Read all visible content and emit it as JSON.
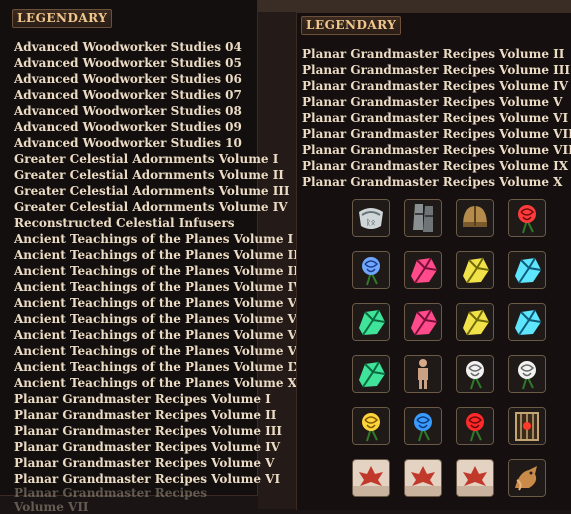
{
  "left_panel": {
    "header": "LEGENDARY",
    "items": [
      "Advanced Woodworker Studies 04",
      "Advanced Woodworker Studies 05",
      "Advanced Woodworker Studies 06",
      "Advanced Woodworker Studies 07",
      "Advanced Woodworker Studies 08",
      "Advanced Woodworker Studies 09",
      "Advanced Woodworker Studies 10",
      "Greater Celestial Adornments Volume I",
      "Greater Celestial Adornments Volume II",
      "Greater Celestial Adornments Volume III",
      "Greater Celestial Adornments Volume IV",
      "Reconstructed Celestial Infusers",
      "Ancient Teachings of the Planes Volume I",
      "Ancient Teachings of the Planes Volume II",
      "Ancient Teachings of the Planes Volume III",
      "Ancient Teachings of the Planes Volume IV",
      "Ancient Teachings of the Planes Volume V",
      "Ancient Teachings of the Planes Volume VI",
      "Ancient Teachings of the Planes Volume VII",
      "Ancient Teachings of the Planes Volume VIII",
      "Ancient Teachings of the Planes Volume IX",
      "Ancient Teachings of the Planes Volume X",
      "Planar Grandmaster Recipes Volume I",
      "Planar Grandmaster Recipes Volume II",
      "Planar Grandmaster Recipes Volume III",
      "Planar Grandmaster Recipes Volume IV",
      "Planar Grandmaster Recipes Volume V",
      "Planar Grandmaster Recipes Volume VI"
    ],
    "cutoff_text": "Planar Grandmaster Recipes Volume VII"
  },
  "right_panel": {
    "header": "LEGENDARY",
    "items": [
      "Planar Grandmaster Recipes Volume II",
      "Planar Grandmaster Recipes Volume III",
      "Planar Grandmaster Recipes Volume IV",
      "Planar Grandmaster Recipes Volume V",
      "Planar Grandmaster Recipes Volume VI",
      "Planar Grandmaster Recipes Volume VII",
      "Planar Grandmaster Recipes Volume VIII",
      "Planar Grandmaster Recipes Volume IX",
      "Planar Grandmaster Recipes Volume X"
    ],
    "icons": [
      [
        "bracer-icon",
        "greaves-icon",
        "helmet-icon",
        "red-lily-icon"
      ],
      [
        "blue-flower-icon",
        "pink-crystal-icon",
        "yellow-crystal-icon",
        "cyan-crystal-icon"
      ],
      [
        "green-crystal-icon",
        "pink-crystal-icon",
        "yellow-crystal-icon",
        "cyan-crystal-icon"
      ],
      [
        "green-crystal-icon",
        "mannequin-icon",
        "white-rose-icon",
        "white-rose-icon"
      ],
      [
        "yellow-rose-icon",
        "blue-rose-icon",
        "red-rose-icon",
        "caged-lantern-icon"
      ],
      [
        "red-leaf-drum-icon",
        "red-leaf-drum-icon",
        "red-leaf-drum-icon",
        "fox-figure-icon"
      ]
    ]
  }
}
